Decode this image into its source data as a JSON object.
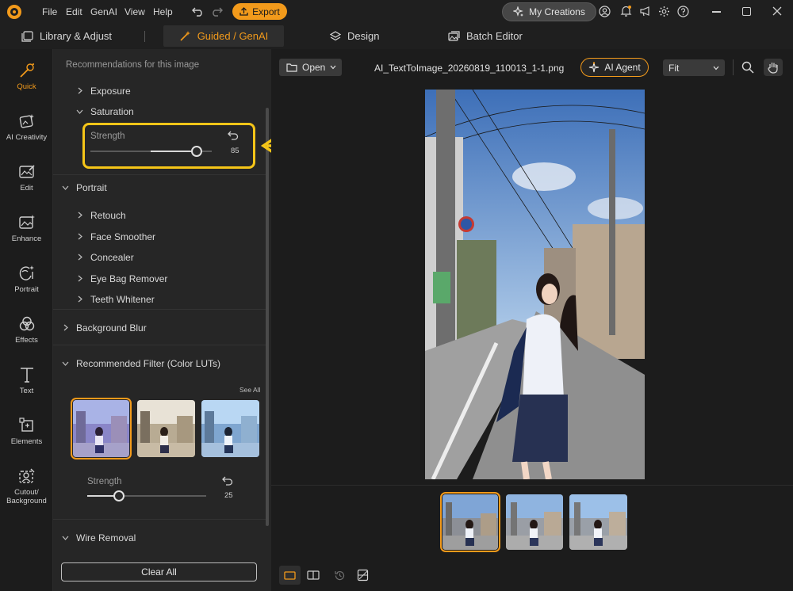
{
  "titlebar": {
    "menu": [
      "File",
      "Edit",
      "GenAI",
      "View",
      "Help"
    ],
    "export_label": "Export",
    "my_creations_label": "My Creations"
  },
  "tabs": {
    "library": "Library & Adjust",
    "guided": "Guided / GenAI",
    "design": "Design",
    "batch": "Batch Editor"
  },
  "rail": [
    {
      "label": "Quick",
      "icon": "magic-wand-icon",
      "active": true
    },
    {
      "label": "AI Creativity",
      "icon": "ai-creativity-icon"
    },
    {
      "label": "Edit",
      "icon": "edit-icon"
    },
    {
      "label": "Enhance",
      "icon": "enhance-icon"
    },
    {
      "label": "Portrait",
      "icon": "portrait-icon"
    },
    {
      "label": "Effects",
      "icon": "effects-icon"
    },
    {
      "label": "Text",
      "icon": "text-icon"
    },
    {
      "label": "Elements",
      "icon": "elements-icon"
    },
    {
      "label": "Cutout/\nBackground",
      "icon": "cutout-icon"
    }
  ],
  "panel": {
    "header": "Recommendations for this image",
    "exposure": "Exposure",
    "saturation": "Saturation",
    "saturation_strength_label": "Strength",
    "saturation_strength_value": "85",
    "portrait": "Portrait",
    "portrait_items": [
      "Retouch",
      "Face Smoother",
      "Concealer",
      "Eye Bag Remover",
      "Teeth Whitener"
    ],
    "background_blur": "Background Blur",
    "recommended_filter": "Recommended Filter (Color LUTs)",
    "see_all": "See All",
    "filter_strength_label": "Strength",
    "filter_strength_value": "25",
    "wire_removal": "Wire Removal",
    "clear_all": "Clear All"
  },
  "viewer": {
    "open_label": "Open",
    "filename": "AI_TextToImage_20260819_110013_1-1.png",
    "ai_agent_label": "AI Agent",
    "zoom_label": "Fit"
  },
  "colors": {
    "accent": "#f29a1b",
    "highlight": "#f5c518"
  }
}
